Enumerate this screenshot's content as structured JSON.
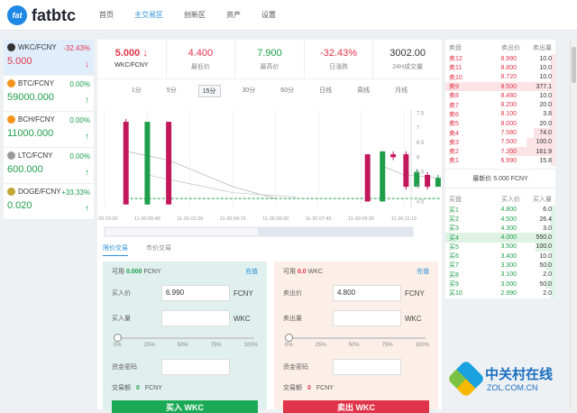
{
  "brand": {
    "badge": "fat",
    "name": "fatbtc"
  },
  "nav": [
    "首页",
    "主交易区",
    "创新区",
    "资产",
    "设置"
  ],
  "nav_active": 1,
  "markets": [
    {
      "name": "WKC/FCNY",
      "change": "-32.43%",
      "price": "5.000",
      "dir": "↓",
      "color": "#e0344a",
      "icon_color": "#333333",
      "selected": true
    },
    {
      "name": "BTC/FCNY",
      "change": "0.00%",
      "price": "59000.000",
      "dir": "↑",
      "color": "#1e9e4a",
      "icon_color": "#f7931a",
      "selected": false
    },
    {
      "name": "BCH/FCNY",
      "change": "0.00%",
      "price": "11000.000",
      "dir": "↑",
      "color": "#1e9e4a",
      "icon_color": "#f7931a",
      "selected": false
    },
    {
      "name": "LTC/FCNY",
      "change": "0.00%",
      "price": "600.000",
      "dir": "↑",
      "color": "#1e9e4a",
      "icon_color": "#9a9a9a",
      "selected": false
    },
    {
      "name": "DOGE/FCNY",
      "change": "+33.33%",
      "price": "0.020",
      "dir": "↑",
      "color": "#1e9e4a",
      "icon_color": "#c2a633",
      "selected": false
    }
  ],
  "ticker": {
    "last": "5.000 ↓",
    "pair": "WKC/FCNY",
    "low": "4.400",
    "low_label": "最低价",
    "high": "7.900",
    "high_label": "最高价",
    "change": "-32.43%",
    "change_label": "日涨跌",
    "volume": "3002.00",
    "volume_label": "24H成交量"
  },
  "periods": [
    "1分",
    "5分",
    "15分",
    "30分",
    "60分",
    "日线",
    "周线",
    "月线"
  ],
  "period_active": 2,
  "chart_data": {
    "type": "candlestick",
    "x_ticks": [
      "11-29 23:00",
      "11-30 00:45",
      "11-30 02:30",
      "11-30 04:15",
      "11-30 06:00",
      "11-30 07:45",
      "11-30 09:30",
      "11-30 11:15"
    ],
    "y_ticks": [
      "7.5",
      "7",
      "6.5",
      "6",
      "5.5",
      "5",
      "4.5"
    ],
    "ylim": [
      4.3,
      7.6
    ],
    "candles": [
      {
        "x": 0.5,
        "open": 7.2,
        "close": 4.4,
        "high": 7.3,
        "low": 4.4,
        "up": false
      },
      {
        "x": 1.0,
        "open": 4.4,
        "close": 7.2,
        "high": 7.2,
        "low": 4.4,
        "up": true
      },
      {
        "x": 1.5,
        "open": 7.2,
        "close": 4.4,
        "high": 7.2,
        "low": 4.4,
        "up": false
      },
      {
        "x": 6.15,
        "open": 6.1,
        "close": 4.5,
        "high": 6.1,
        "low": 4.5,
        "up": false
      },
      {
        "x": 6.5,
        "open": 4.5,
        "close": 6.2,
        "high": 6.2,
        "low": 4.5,
        "up": true
      },
      {
        "x": 6.75,
        "open": 6.1,
        "close": 6.0,
        "high": 6.2,
        "low": 5.9,
        "up": false
      },
      {
        "x": 7.05,
        "open": 6.1,
        "close": 5.0,
        "high": 6.2,
        "low": 4.9,
        "up": false
      },
      {
        "x": 7.3,
        "open": 5.0,
        "close": 5.5,
        "high": 5.6,
        "low": 5.0,
        "up": true
      },
      {
        "x": 7.55,
        "open": 5.4,
        "close": 5.0,
        "high": 5.5,
        "low": 4.9,
        "up": false
      },
      {
        "x": 7.8,
        "open": 5.0,
        "close": 5.3,
        "high": 5.4,
        "low": 5.0,
        "up": true
      }
    ],
    "baseline": 4.6
  },
  "order_tabs": [
    "限价交易",
    "市价交易"
  ],
  "buy": {
    "avail_label": "可用",
    "avail": "0.000",
    "avail_unit": "FCNY",
    "link": "充值",
    "price_label": "买入价",
    "price": "6.990",
    "price_unit": "FCNY",
    "qty_label": "买入量",
    "qty_unit": "WKC",
    "pcts": [
      "0%",
      "25%",
      "50%",
      "75%",
      "100%"
    ],
    "pwd_label": "资金密码",
    "amount_label": "交易额",
    "amount": "0",
    "amount_unit": "FCNY",
    "button": "买入 WKC"
  },
  "sell": {
    "avail_label": "可用",
    "avail": "0.0",
    "avail_unit": "WKC",
    "link": "充值",
    "price_label": "卖出价",
    "price": "4.800",
    "price_unit": "FCNY",
    "qty_label": "卖出量",
    "qty_unit": "WKC",
    "pcts": [
      "0%",
      "25%",
      "50%",
      "75%",
      "100%"
    ],
    "pwd_label": "资金密码",
    "amount_label": "交易额",
    "amount": "0",
    "amount_unit": "FCNY",
    "button": "卖出 WKC"
  },
  "book": {
    "ask_head": [
      "卖盘",
      "卖出价",
      "卖出量"
    ],
    "asks": [
      [
        "卖12",
        "8.990",
        "10.0"
      ],
      [
        "卖11",
        "8.800",
        "10.0"
      ],
      [
        "卖10",
        "8.720",
        "10.0"
      ],
      [
        "卖9",
        "8.500",
        "377.1"
      ],
      [
        "卖8",
        "8.480",
        "10.0"
      ],
      [
        "卖7",
        "8.200",
        "20.0"
      ],
      [
        "卖6",
        "8.100",
        "3.8"
      ],
      [
        "卖5",
        "8.000",
        "20.0"
      ],
      [
        "卖4",
        "7.580",
        "74.0"
      ],
      [
        "卖3",
        "7.500",
        "100.0"
      ],
      [
        "卖2",
        "7.200",
        "161.9"
      ],
      [
        "卖1",
        "6.990",
        "15.8"
      ]
    ],
    "last": "最新价 5.000 FCNY",
    "bid_head": [
      "买盘",
      "买入价",
      "买入量"
    ],
    "bids": [
      [
        "买1",
        "4.800",
        "6.0"
      ],
      [
        "买2",
        "4.500",
        "26.4"
      ],
      [
        "买3",
        "4.300",
        "3.0"
      ],
      [
        "买4",
        "4.000",
        "550.0"
      ],
      [
        "买5",
        "3.500",
        "100.0"
      ],
      [
        "买6",
        "3.400",
        "10.0"
      ],
      [
        "买7",
        "3.300",
        "50.0"
      ],
      [
        "买8",
        "3.100",
        "2.0"
      ],
      [
        "买9",
        "3.000",
        "50.0"
      ],
      [
        "买10",
        "2.990",
        "2.0"
      ]
    ]
  },
  "watermark": {
    "name": "中关村在线",
    "url": "ZOL.COM.CN"
  }
}
